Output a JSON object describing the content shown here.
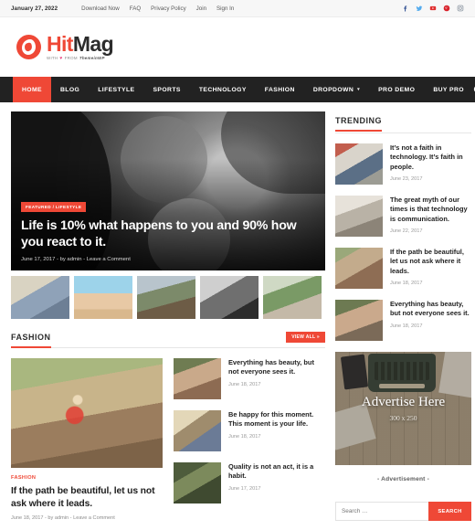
{
  "topbar": {
    "date": "January 27, 2022",
    "links": [
      {
        "label": "Download Now"
      },
      {
        "label": "FAQ"
      },
      {
        "label": "Privacy Policy"
      },
      {
        "label": "Join"
      },
      {
        "label": "Sign In"
      }
    ],
    "social": [
      {
        "name": "facebook-icon",
        "glyph": "f",
        "color": "#3b5998"
      },
      {
        "name": "twitter-icon",
        "glyph": "t",
        "color": "#55acee"
      },
      {
        "name": "youtube-icon",
        "glyph": "y",
        "color": "#e02f2f"
      },
      {
        "name": "pinterest-icon",
        "glyph": "p",
        "color": "#d8212a"
      },
      {
        "name": "instagram-icon",
        "glyph": "i",
        "color": "#9aa3ad"
      }
    ]
  },
  "logo": {
    "name_first": "Hit",
    "name_second": "Mag",
    "tagline_prefix": "WITH",
    "tagline_heart": "♥",
    "tagline_mid": "FROM",
    "tagline_brand": "ThemeinWP"
  },
  "nav": {
    "items": [
      {
        "label": "HOME",
        "active": true,
        "dropdown": false
      },
      {
        "label": "BLOG",
        "active": false,
        "dropdown": false
      },
      {
        "label": "LIFESTYLE",
        "active": false,
        "dropdown": false
      },
      {
        "label": "SPORTS",
        "active": false,
        "dropdown": false
      },
      {
        "label": "TECHNOLOGY",
        "active": false,
        "dropdown": false
      },
      {
        "label": "FASHION",
        "active": false,
        "dropdown": false
      },
      {
        "label": "DROPDOWN",
        "active": false,
        "dropdown": true
      },
      {
        "label": "PRO DEMO",
        "active": false,
        "dropdown": false
      },
      {
        "label": "BUY PRO",
        "active": false,
        "dropdown": false
      }
    ],
    "caret": "▾",
    "search_icon": "search-icon"
  },
  "hero": {
    "badge": "FEATURED / LIFESTYLE",
    "title": "Life is 10% what happens to you and 90% how you react to it.",
    "meta": "June 17, 2017  -  by admin  -  Leave a Comment"
  },
  "thumbs": [
    {
      "name": "thumbnail-1"
    },
    {
      "name": "thumbnail-2"
    },
    {
      "name": "thumbnail-3"
    },
    {
      "name": "thumbnail-4"
    },
    {
      "name": "thumbnail-5"
    }
  ],
  "fashion_section": {
    "title": "FASHION",
    "view_all": "VIEW ALL »",
    "featured": {
      "category": "FASHION",
      "title": "If the path be beautiful, let us not ask where it leads.",
      "meta": "June 18, 2017  -  by admin  -  Leave a Comment"
    },
    "items": [
      {
        "title": "Everything has beauty, but not everyone sees it.",
        "date": "June 18, 2017"
      },
      {
        "title": "Be happy for this moment. This moment is your life.",
        "date": "June 18, 2017"
      },
      {
        "title": "Quality is not an act, it is a habit.",
        "date": "June 17, 2017"
      }
    ]
  },
  "sidebar": {
    "trending": {
      "title": "TRENDING",
      "items": [
        {
          "title": "It’s not a faith in technology. It’s faith in people.",
          "date": "June 23, 2017"
        },
        {
          "title": "The great myth of our times is that technology is communication.",
          "date": "June 22, 2017"
        },
        {
          "title": "If the path be beautiful, let us not ask where it leads.",
          "date": "June 18, 2017"
        },
        {
          "title": "Everything has beauty, but not everyone sees it.",
          "date": "June 18, 2017"
        }
      ]
    },
    "ad": {
      "headline": "Advertise Here",
      "size": "300 x 250",
      "caption": "- Advertisement -"
    },
    "search": {
      "placeholder": "Search …",
      "button": "SEARCH"
    }
  },
  "colors": {
    "accent": "#ef4836",
    "nav_bg": "#222222",
    "topbar_bg": "#f7f7f7",
    "text": "#1f1f1f",
    "muted": "#9a9a9a"
  }
}
